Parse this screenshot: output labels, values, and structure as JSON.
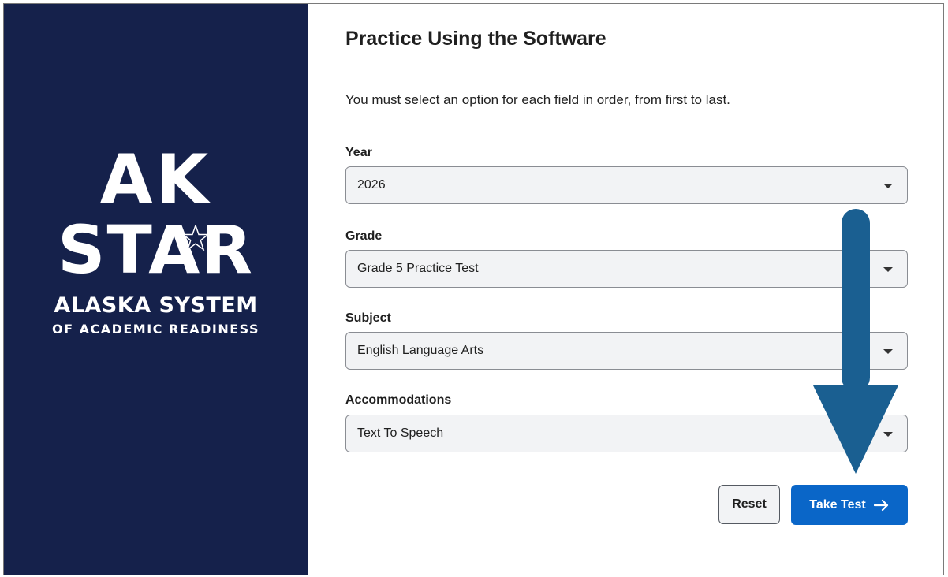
{
  "logo": {
    "line_ak": "AK",
    "line_star": "STAR",
    "line_system": "ALASKA SYSTEM",
    "line_readiness": "OF ACADEMIC READINESS"
  },
  "page": {
    "title": "Practice Using the Software",
    "instructions": "You must select an option for each field in order, from first to last."
  },
  "fields": [
    {
      "label": "Year",
      "value": "2026"
    },
    {
      "label": "Grade",
      "value": "Grade 5 Practice Test"
    },
    {
      "label": "Subject",
      "value": "English Language Arts"
    },
    {
      "label": "Accommodations",
      "value": "Text To Speech"
    }
  ],
  "buttons": {
    "reset": "Reset",
    "take_test": "Take Test"
  },
  "icons": {
    "select_caret": "chevron-down-icon",
    "take_test_arrow": "arrow-right-icon",
    "callout": "down-arrow-callout"
  },
  "colors": {
    "sidebar_bg": "#15214b",
    "primary_button": "#0a66c8",
    "callout_arrow": "#1a5f91"
  }
}
